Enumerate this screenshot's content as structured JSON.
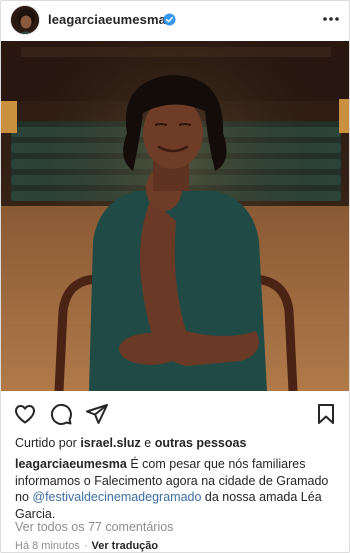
{
  "post": {
    "username": "leagarciaeumesma",
    "verified": true,
    "more_icon": "more-horizontal-icon"
  },
  "actions": {
    "like_icon": "heart-icon",
    "comment_icon": "comment-icon",
    "share_icon": "send-icon",
    "save_icon": "bookmark-icon"
  },
  "likes": {
    "prefix": "Curtido por",
    "user": "israel.sluz",
    "joiner": "e",
    "others": "outras pessoas"
  },
  "caption": {
    "user": "leagarciaeumesma",
    "text_before": "É com pesar que nós familiares informamos o Falecimento agora na cidade de Gramado no",
    "mention": "@festivaldecinemadegramado",
    "text_after": "da nossa amada Léa Garcia."
  },
  "comments": {
    "view_all": "Ver todos os 77 comentários"
  },
  "meta": {
    "time": "Há 8 minutos",
    "separator": "·",
    "translate": "Ver tradução"
  },
  "colors": {
    "text": "#262626",
    "muted": "#8e8e8e",
    "mention": "#3d6fa3",
    "verified": "#3897f0"
  }
}
